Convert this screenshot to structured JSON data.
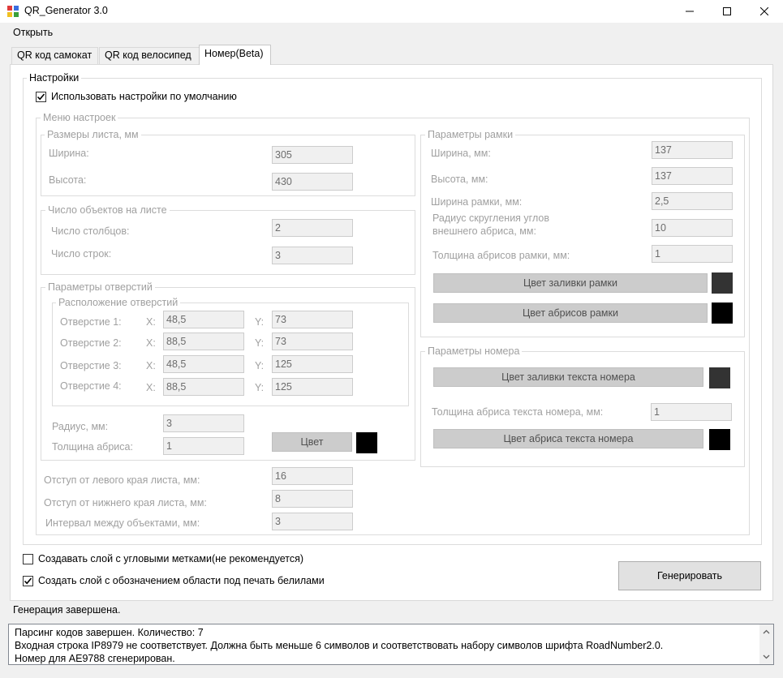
{
  "window": {
    "title": "QR_Generator 3.0",
    "minimize": "—",
    "maximize": "☐",
    "close": "✕"
  },
  "menu": {
    "open": "Открыть"
  },
  "tabs": [
    "QR код самокат",
    "QR код велосипед",
    "Номер(Beta)"
  ],
  "settings": {
    "title": "Настройки",
    "use_defaults": "Использовать настройки по умолчанию",
    "menu_title": "Меню настроек"
  },
  "sheet": {
    "title": "Размеры листа, мм",
    "width_label": "Ширина:",
    "width": "305",
    "height_label": "Высота:",
    "height": "430"
  },
  "objects": {
    "title": "Число объектов на листе",
    "cols_label": "Число столбцов:",
    "cols": "2",
    "rows_label": "Число строк:",
    "rows": "3"
  },
  "holes": {
    "title": "Параметры отверстий",
    "layout_title": "Расположение отверстий",
    "x_label": "X:",
    "y_label": "Y:",
    "items": [
      {
        "label": "Отверстие 1:",
        "x": "48,5",
        "y": "73"
      },
      {
        "label": "Отверстие 2:",
        "x": "88,5",
        "y": "73"
      },
      {
        "label": "Отверстие 3:",
        "x": "48,5",
        "y": "125"
      },
      {
        "label": "Отверстие 4:",
        "x": "88,5",
        "y": "125"
      }
    ],
    "radius_label": "Радиус, мм:",
    "radius": "3",
    "stroke_label": "Толщина абриса:",
    "stroke": "1",
    "color_button": "Цвет",
    "color_swatch": "#000000"
  },
  "offsets": {
    "left_label": "Отступ от левого края листа, мм:",
    "left": "16",
    "bottom_label": "Отступ от нижнего края листа, мм:",
    "bottom": "8",
    "interval_label": "Интервал между объектами, мм:",
    "interval": "3"
  },
  "frame": {
    "title": "Параметры рамки",
    "width_label": "Ширина, мм:",
    "width": "137",
    "height_label": "Высота, мм:",
    "height": "137",
    "frame_width_label": "Ширина рамки, мм:",
    "frame_width": "2,5",
    "radius_label_1": "Радиус скругления углов",
    "radius_label_2": "внешнего абриса, мм:",
    "radius": "10",
    "stroke_label": "Толщина абрисов рамки, мм:",
    "stroke": "1",
    "fill_button": "Цвет заливки рамки",
    "fill_swatch": "#333333",
    "stroke_button": "Цвет абрисов рамки",
    "stroke_swatch": "#000000"
  },
  "number": {
    "title": "Параметры номера",
    "fill_button": "Цвет заливки текста номера",
    "fill_swatch": "#333333",
    "stroke_label": "Толщина абриса текста номера, мм:",
    "stroke": "1",
    "stroke_button": "Цвет абриса текста номера",
    "stroke_swatch": "#000000"
  },
  "options": {
    "corner_marks": "Создавать слой с угловыми метками(не рекомендуется)",
    "corner_marks_checked": false,
    "white_layer": "Создать слой с обозначением области под печать белилами",
    "white_layer_checked": true
  },
  "generate_button": "Генерировать",
  "status": "Генерация завершена.",
  "log": [
    "Парсинг кодов завершен. Количество: 7",
    "Входная строка IP8979 не соответствует. Должна быть меньше 6 символов и соответствовать набору символов шрифта RoadNumber2.0.",
    "Номер для AE9788 сгенерирован."
  ]
}
